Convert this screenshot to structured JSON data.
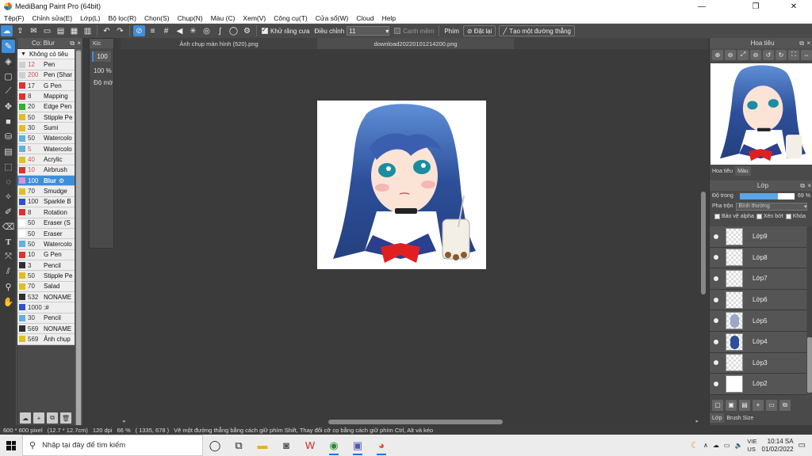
{
  "window": {
    "title": "MediBang Paint Pro (64bit)",
    "minimize": "—",
    "maximize": "❐",
    "close": "✕"
  },
  "menu": [
    "Tệp(F)",
    "Chỉnh sửa(E)",
    "Lớp(L)",
    "Bộ lọc(R)",
    "Chọn(S)",
    "Chụp(N)",
    "Màu (C)",
    "Xem(V)",
    "Công cụ(T)",
    "Cửa sổ(W)",
    "Cloud",
    "Help"
  ],
  "toolbar": {
    "antialias_label": "Khử răng cưa",
    "correction_label": "Điều chỉnh",
    "correction_value": "11",
    "soft_label": "Cạnh mềm",
    "key_label": "Phím",
    "reset_label": "Đặt lại",
    "straight_line_label": "Tạo một đường thẳng"
  },
  "brush_panel": {
    "title": "Cọ: Blur",
    "header": "Không có tiêu",
    "brushes": [
      {
        "size": "12",
        "name": "Pen",
        "color": "#d0d0d0",
        "size_red": true
      },
      {
        "size": "200",
        "name": "Pen (Shar",
        "color": "#d0d0d0",
        "size_red": true
      },
      {
        "size": "17",
        "name": "G Pen",
        "color": "#e03030"
      },
      {
        "size": "8",
        "name": "Mapping",
        "color": "#e03030"
      },
      {
        "size": "20",
        "name": "Edge Pen",
        "color": "#30b030"
      },
      {
        "size": "50",
        "name": "Stipple Pe",
        "color": "#e0c020"
      },
      {
        "size": "30",
        "name": "Sumi",
        "color": "#e0c020"
      },
      {
        "size": "50",
        "name": "Watercolo",
        "color": "#60b0e0"
      },
      {
        "size": "5",
        "name": "Watercolo",
        "color": "#60b0e0",
        "size_red": true
      },
      {
        "size": "40",
        "name": "Acrylic",
        "color": "#e0c020",
        "size_red": true
      },
      {
        "size": "10",
        "name": "Airbrush",
        "color": "#e03030",
        "size_red": true
      },
      {
        "size": "100",
        "name": "Blur",
        "color": "#e090d0",
        "selected": true
      },
      {
        "size": "70",
        "name": "Smudge",
        "color": "#e0c020"
      },
      {
        "size": "100",
        "name": "Sparkle B",
        "color": "#3050d0"
      },
      {
        "size": "8",
        "name": "Rotation",
        "color": "#e03030"
      },
      {
        "size": "50",
        "name": "Eraser (S",
        "color": "#ffffff"
      },
      {
        "size": "50",
        "name": "Eraser",
        "color": "#ffffff"
      },
      {
        "size": "50",
        "name": "Watercolo",
        "color": "#60b0e0"
      },
      {
        "size": "10",
        "name": "G Pen",
        "color": "#e03030"
      },
      {
        "size": "3",
        "name": "Pencil",
        "color": "#303030"
      },
      {
        "size": "50",
        "name": "Stipple Pe",
        "color": "#e0c020"
      },
      {
        "size": "70",
        "name": "Salad",
        "color": "#e0c020"
      },
      {
        "size": "532",
        "name": "NONAME",
        "color": "#303030"
      },
      {
        "size": "1000",
        "name": ":#",
        "color": "#3050d0"
      },
      {
        "size": "30",
        "name": "Pencil",
        "color": "#60b0e0"
      },
      {
        "size": "569",
        "name": "NONAME",
        "color": "#303030"
      },
      {
        "size": "569",
        "name": "Ảnh chụp",
        "color": "#e0c020"
      }
    ]
  },
  "size_panel": {
    "title": "Kíc",
    "size_value": "100",
    "opacity_value": "100 %",
    "label": "Độ mờ"
  },
  "canvas": {
    "tabs": [
      "Ảnh chụp màn hình (520).png",
      "download20220101214200.png"
    ]
  },
  "navigator": {
    "title": "Hoa tiêu",
    "tabs": [
      "Hoa tiêu",
      "Màu"
    ]
  },
  "layers": {
    "title": "Lớp",
    "opacity_label": "Độ trong",
    "opacity_value": "69 %",
    "opacity_fraction": 0.69,
    "blend_label": "Pha trộn",
    "blend_value": "Bình thường",
    "protect_alpha": "Bảo vệ alpha",
    "clipping": "Xén bớt",
    "lock": "Khóa",
    "items": [
      "Lớp9",
      "Lớp8",
      "Lớp7",
      "Lớp6",
      "Lớp5",
      "Lớp4",
      "Lớp3",
      "Lớp2"
    ],
    "bottom_tabs": [
      "Lớp",
      "Brush Size"
    ]
  },
  "status": {
    "dimensions": "600 * 600 pixel",
    "physical": "(12.7 * 12.7cm)",
    "dpi": "120 dpi",
    "zoom": "66 %",
    "coords": "( 1335, 678 )",
    "hint": "Vẽ một đường thẳng bằng cách giữ phím Shift, Thay đổi cỡ cọ bằng cách giữ phím Ctrl, Alt và kéo"
  },
  "taskbar": {
    "search_placeholder": "Nhập tại đây để tìm kiếm",
    "lang_top": "VIE",
    "lang_bottom": "US",
    "time": "10:14 SA",
    "date": "01/02/2022"
  }
}
